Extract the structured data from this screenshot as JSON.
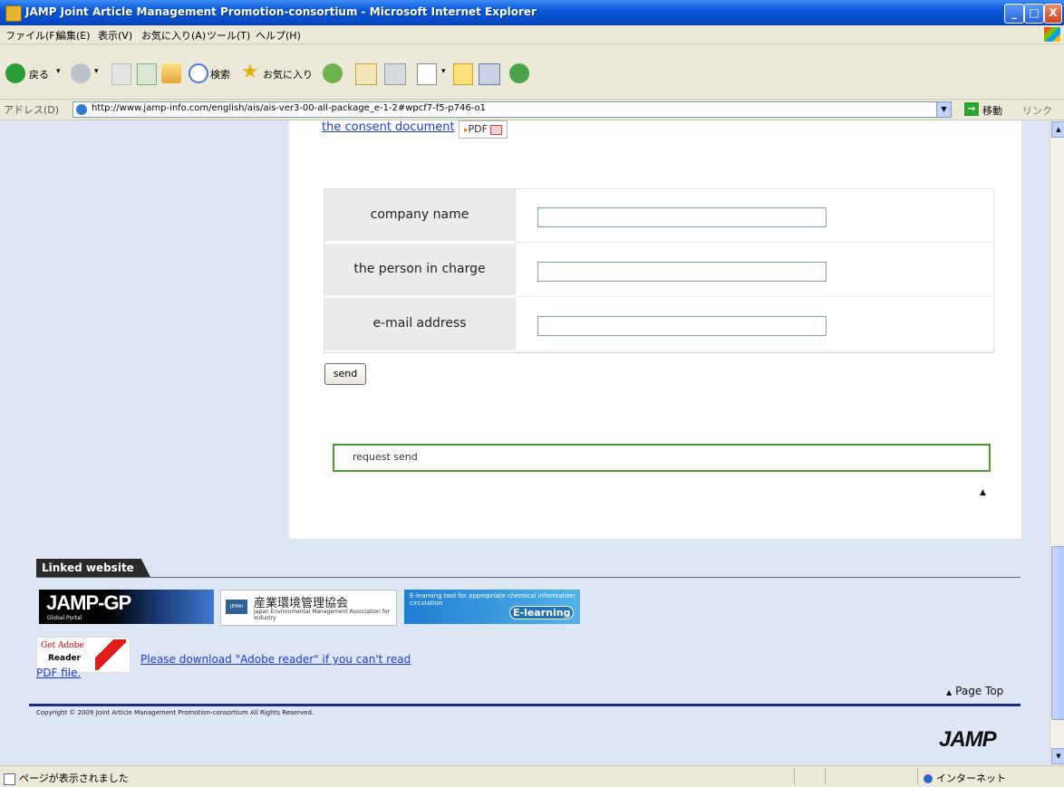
{
  "window": {
    "title": "JAMP  Joint Article Management Promotion-consortium - Microsoft Internet Explorer",
    "buttons": {
      "minimize": "_",
      "maximize": "□",
      "close": "X"
    }
  },
  "menu": [
    "ファイル(F)",
    "編集(E)",
    "表示(V)",
    "お気に入り(A)",
    "ツール(T)",
    "ヘルプ(H)"
  ],
  "toolbar": {
    "back_label": "戻る",
    "search_label": "検索",
    "favorites_label": "お気に入り"
  },
  "address": {
    "label": "アドレス(D)",
    "url": "http://www.jamp-info.com/english/ais/ais-ver3-00-all-package_e-1-2#wpcf7-f5-p746-o1",
    "go_label": "移動",
    "links_label": "リンク"
  },
  "page": {
    "consent_link": "the consent document",
    "pdf_badge": "PDF",
    "form": {
      "rows": [
        {
          "label": "company name",
          "value": ""
        },
        {
          "label": "the person in charge",
          "value": ""
        },
        {
          "label": "e-mail address",
          "value": ""
        }
      ],
      "send_label": "send"
    },
    "request_box": "request send",
    "linked_website": {
      "heading": "Linked website",
      "banners": {
        "gp_title": "JAMP-GP",
        "gp_sub": "Global Portal",
        "jemai_logo": "JEMAI",
        "jemai_jp": "産業環境管理協会",
        "jemai_en": "Japan Environmental Management Association for Industry",
        "elearning_text": "E-learning tool for appropriate chemical information circulation",
        "elearning_badge": "E-learning"
      }
    },
    "adobe": {
      "get_label": "Get Adobe",
      "reader_label": "Reader",
      "text_line1": "Please download \"Adobe reader\" if you can't read",
      "text_line2": "PDF file."
    },
    "page_top": "Page Top",
    "copyright": "Copyright © 2009 Joint Article Management Promotion-consortium All Rights Reserved.",
    "jamp_logo": "JAMP"
  },
  "status": {
    "left": "ページが表示されました",
    "right": "インターネット"
  }
}
